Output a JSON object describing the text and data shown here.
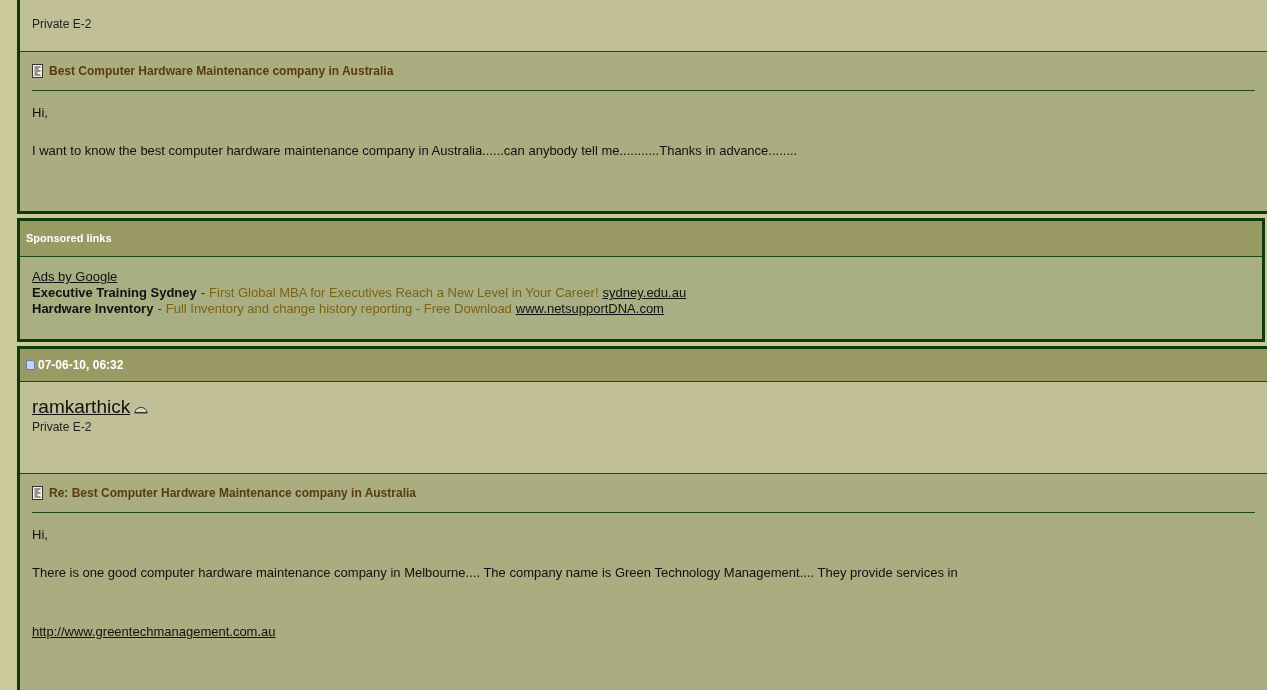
{
  "first_post": {
    "rank": "Private E-2",
    "title": "Best Computer Hardware Maintenance company in Australia",
    "body": [
      {
        "kind": "text",
        "text": "Hi,"
      },
      {
        "kind": "text",
        "text": "I want to know the best computer hardware maintenance company in Australia......can anybody tell me...........Thanks in advance........"
      }
    ]
  },
  "sponsored": {
    "heading": "Sponsored links",
    "source": "Ads by Google",
    "ads": [
      {
        "name": "Executive Training Sydney",
        "separator": "-",
        "description": "First Global MBA for Executives Reach a New Level in Your Career!",
        "url": "sydney.edu.au"
      },
      {
        "name": "Hardware Inventory",
        "separator": "-",
        "description": "Full Inventory and change history reporting - Free Download",
        "url": "www.netsupportDNA.com"
      }
    ]
  },
  "second_post": {
    "date": "07-06-10, 06:32",
    "username": "ramkarthick",
    "rank": "Private E-2",
    "title": "Re: Best Computer Hardware Maintenance company in Australia",
    "body": [
      {
        "kind": "text",
        "text": "Hi,"
      },
      {
        "kind": "text",
        "text": "There is one good computer hardware maintenance company in Melbourne.... The company name is Green Technology Management.... They provide services in"
      },
      {
        "kind": "link",
        "text": "http://www.greentechmanagement.com.au"
      }
    ]
  }
}
